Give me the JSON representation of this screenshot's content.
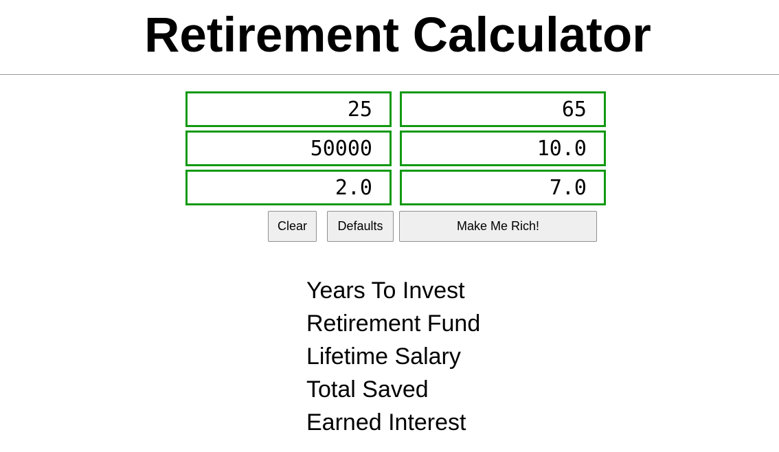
{
  "header": {
    "title": "Retirement Calculator"
  },
  "form": {
    "fields": [
      {
        "value": "25"
      },
      {
        "value": "65"
      },
      {
        "value": "50000"
      },
      {
        "value": "10.0"
      },
      {
        "value": "2.0"
      },
      {
        "value": "7.0"
      }
    ],
    "border_color": "#119911"
  },
  "buttons": {
    "clear_label": "Clear",
    "defaults_label": "Defaults",
    "submit_label": "Make Me Rich!"
  },
  "results": {
    "items": [
      {
        "label": "Years To Invest"
      },
      {
        "label": "Retirement Fund"
      },
      {
        "label": "Lifetime Salary"
      },
      {
        "label": "Total Saved"
      },
      {
        "label": "Earned Interest"
      }
    ]
  }
}
